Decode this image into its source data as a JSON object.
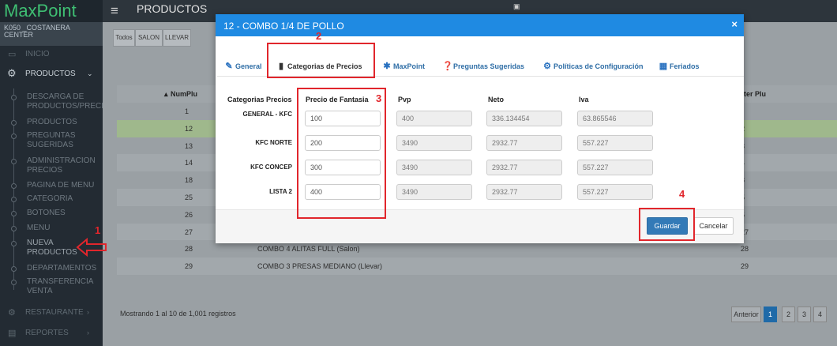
{
  "app": {
    "logo": "MaxPoint",
    "store": "K050 _COSTANERA CENTER",
    "page_title": "PRODUCTOS"
  },
  "sidebar": {
    "inicio": "INICIO",
    "productos": "PRODUCTOS",
    "sub_items": [
      "DESCARGA DE PRODUCTOS/PRECIO",
      "PRODUCTOS",
      "PREGUNTAS SUGERIDAS",
      "ADMINISTRACION PRECIOS",
      "PAGINA DE MENU",
      "CATEGORIA",
      "BOTONES",
      "MENU",
      "NUEVA PRODUCTOS",
      "DEPARTAMENTOS",
      "TRANSFERENCIA VENTA"
    ],
    "restaurante": "RESTAURANTE",
    "reportes": "REPORTES"
  },
  "filters": [
    "Todos",
    "SALON",
    "LLEVAR"
  ],
  "table": {
    "col_numplu": "NumPlu",
    "col_masterplu": "ter Plu",
    "rows": [
      {
        "num": "1",
        "desc": "",
        "master": ""
      },
      {
        "num": "12",
        "desc": "",
        "master": "2"
      },
      {
        "num": "13",
        "desc": "",
        "master": "3"
      },
      {
        "num": "14",
        "desc": "",
        "master": "4"
      },
      {
        "num": "18",
        "desc": "",
        "master": "8"
      },
      {
        "num": "25",
        "desc": "",
        "master": "5"
      },
      {
        "num": "26",
        "desc": "",
        "master": "6"
      },
      {
        "num": "27",
        "desc": "PROMO 1/4 POLLO REGULAR (Salon)",
        "master": "27"
      },
      {
        "num": "28",
        "desc": "COMBO 4 ALITAS FULL (Salon)",
        "master": "28"
      },
      {
        "num": "29",
        "desc": "COMBO 3 PRESAS MEDIANO (Llevar)",
        "master": "29"
      }
    ],
    "footer": "Mostrando 1 al 10 de 1,001 registros",
    "pager": [
      "Anterior",
      "1",
      "2",
      "3",
      "4"
    ]
  },
  "modal": {
    "title": "12 - COMBO 1/4 DE POLLO",
    "close": "×",
    "tabs": [
      {
        "label": "General",
        "icon": "edit-icon"
      },
      {
        "label": "Categorias de Precios",
        "icon": "bar-chart-icon"
      },
      {
        "label": "MaxPoint",
        "icon": "asterisk-icon"
      },
      {
        "label": "Preguntas Sugeridas",
        "icon": "question-icon"
      },
      {
        "label": "Políticas de Configuración",
        "icon": "gear-icon"
      },
      {
        "label": "Feriados",
        "icon": "calendar-icon"
      }
    ],
    "columns": [
      "Categorias Precios",
      "Precio de Fantasia",
      "Pvp",
      "Neto",
      "Iva"
    ],
    "rows": [
      {
        "label": "GENERAL - KFC",
        "fantasia": "100",
        "pvp": "400",
        "neto": "336.134454",
        "iva": "63.865546"
      },
      {
        "label": "KFC NORTE",
        "fantasia": "200",
        "pvp": "3490",
        "neto": "2932.77",
        "iva": "557.227"
      },
      {
        "label": "KFC CONCEP",
        "fantasia": "300",
        "pvp": "3490",
        "neto": "2932.77",
        "iva": "557.227"
      },
      {
        "label": "LISTA 2",
        "fantasia": "400",
        "pvp": "3490",
        "neto": "2932.77",
        "iva": "557.227"
      }
    ],
    "save": "Guardar",
    "cancel": "Cancelar"
  },
  "annotations": [
    "1",
    "2",
    "3",
    "4"
  ],
  "colors": {
    "modal_header": "#1f8ae2",
    "annotation": "#e1262c",
    "save_button": "#337ab7",
    "highlight_row": "#9fb88c"
  }
}
